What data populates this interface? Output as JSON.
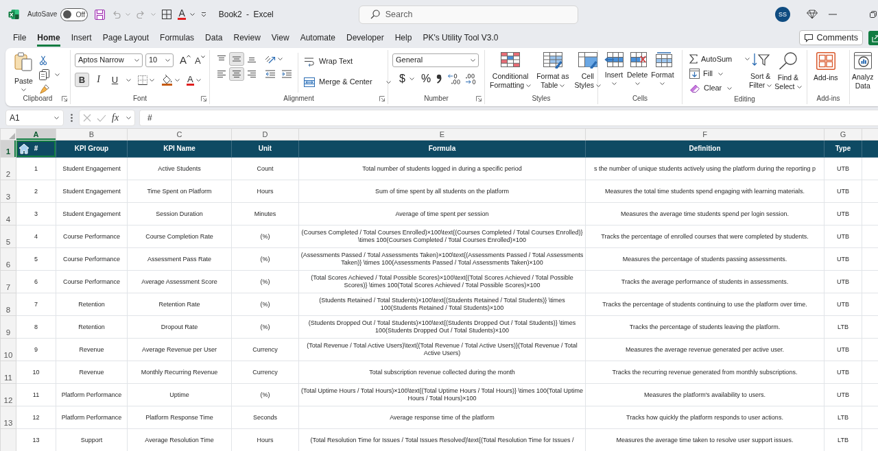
{
  "title_bar": {
    "autosave": {
      "label": "AutoSave",
      "on": false,
      "state_text": "Off"
    },
    "undo": {
      "disabled": true
    },
    "redo": {
      "disabled": true
    },
    "font_color": {
      "glyph": "A"
    },
    "title": "Book2 - Excel",
    "search": {
      "placeholder": "Search"
    },
    "account": {
      "initials": "SS"
    }
  },
  "ribbon_tabs": [
    {
      "label": "File",
      "selected": false
    },
    {
      "label": "Home",
      "selected": true
    },
    {
      "label": "Insert",
      "selected": false
    },
    {
      "label": "Page Layout",
      "selected": false
    },
    {
      "label": "Formulas",
      "selected": false
    },
    {
      "label": "Data",
      "selected": false
    },
    {
      "label": "Review",
      "selected": false
    },
    {
      "label": "View",
      "selected": false
    },
    {
      "label": "Automate",
      "selected": false
    },
    {
      "label": "Developer",
      "selected": false
    },
    {
      "label": "Help",
      "selected": false
    },
    {
      "label": "PK's Utility Tool V3.0",
      "selected": false
    }
  ],
  "comments_button": {
    "label": "Comments"
  },
  "ribbon": {
    "groups": [
      {
        "kind": "clipboard",
        "label": "Clipboard",
        "launcher": true,
        "paste": "Paste"
      },
      {
        "kind": "font",
        "label": "Font",
        "launcher": true,
        "font_name": "Aptos Narrow",
        "font_size": "10",
        "grow": "A",
        "shrink": "A",
        "style_buttons": [
          {
            "text": "B",
            "pressed": true
          },
          {
            "text": "I",
            "pressed": false
          },
          {
            "text": "U",
            "pressed": false
          }
        ],
        "font_color": "A"
      },
      {
        "kind": "alignment",
        "label": "Alignment",
        "launcher": true,
        "vertical": [
          {
            "selected": false
          },
          {
            "selected": true
          },
          {
            "selected": false
          }
        ],
        "horizontal": [
          {
            "selected": false
          },
          {
            "selected": true
          },
          {
            "selected": false
          }
        ],
        "wrap_text": "Wrap Text",
        "merge": "Merge & Center"
      },
      {
        "kind": "number",
        "label": "Number",
        "launcher": true,
        "format": "General",
        "currency": "$",
        "percent": "%"
      },
      {
        "kind": "styles",
        "label": "Styles",
        "buttons": [
          {
            "label": "Conditional\nFormatting",
            "caret": true
          },
          {
            "label": "Format as\nTable",
            "caret": true
          },
          {
            "label": "Cell\nStyles",
            "caret": true
          }
        ]
      },
      {
        "kind": "cells",
        "label": "Cells",
        "buttons": [
          {
            "label": "Insert",
            "caret": true
          },
          {
            "label": "Delete",
            "caret": true
          },
          {
            "label": "Format",
            "caret": true
          }
        ]
      },
      {
        "kind": "editing",
        "label": "Editing",
        "small": [
          {
            "label": "AutoSum",
            "caret": true
          },
          {
            "label": "Fill",
            "caret": true
          },
          {
            "label": "Clear",
            "caret": true
          }
        ],
        "large": [
          {
            "label": "Sort &\nFilter",
            "caret": true
          },
          {
            "label": "Find &\nSelect",
            "caret": true
          }
        ]
      },
      {
        "kind": "addins",
        "label": "Add-ins",
        "buttons": [
          {
            "label": "Add-ins"
          }
        ]
      },
      {
        "kind": "analyze",
        "buttons": [
          {
            "label": "Analyz\nData"
          }
        ]
      }
    ]
  },
  "formula_bar": {
    "name_box": "A1",
    "cancel": {
      "disabled": true
    },
    "enter": {
      "disabled": true
    },
    "function_label": "fx",
    "formula": "#"
  },
  "sheet": {
    "columns": [
      {
        "label": "A",
        "selected": true
      },
      {
        "label": "B",
        "selected": false
      },
      {
        "label": "C",
        "selected": false
      },
      {
        "label": "D",
        "selected": false
      },
      {
        "label": "E",
        "selected": false
      },
      {
        "label": "F",
        "selected": false
      },
      {
        "label": "G",
        "selected": false
      }
    ],
    "rows": [
      {
        "number": "1",
        "selected": true,
        "kind": "header",
        "cells": [
          "#",
          "KPI Group",
          "KPI Name",
          "Unit",
          "Formula",
          "Definition",
          "Type"
        ]
      },
      {
        "number": "2",
        "selected": false,
        "kind": "data",
        "cells": [
          "1",
          "Student Engagement",
          "Active Students",
          "Count",
          "Total number of students logged in during a specific period",
          "s the number of unique students actively using the platform during the reporting p",
          "UTB"
        ]
      },
      {
        "number": "3",
        "selected": false,
        "kind": "data",
        "cells": [
          "2",
          "Student Engagement",
          "Time Spent on Platform",
          "Hours",
          "Sum of time spent by all students on the platform",
          "Measures the total time students spend engaging with learning materials.",
          "UTB"
        ]
      },
      {
        "number": "4",
        "selected": false,
        "kind": "data",
        "cells": [
          "3",
          "Student Engagement",
          "Session Duration",
          "Minutes",
          "Average of time spent per session",
          "Measures the average time students spend per login session.",
          "UTB"
        ]
      },
      {
        "number": "5",
        "selected": false,
        "kind": "data",
        "cells": [
          "4",
          "Course Performance",
          "Course Completion Rate",
          "(%)",
          "(Courses Completed / Total Courses Enrolled)×100\\text{(Courses Completed / Total Courses Enrolled)} \\times 100(Courses Completed / Total Courses Enrolled)×100",
          "Tracks the percentage of enrolled courses that were completed by students.",
          "UTB"
        ]
      },
      {
        "number": "6",
        "selected": false,
        "kind": "data",
        "cells": [
          "5",
          "Course Performance",
          "Assessment Pass Rate",
          "(%)",
          "(Assessments Passed / Total Assessments Taken)×100\\text{(Assessments Passed / Total Assessments Taken)} \\times 100(Assessments Passed / Total Assessments Taken)×100",
          "Measures the percentage of students passing assessments.",
          "UTB"
        ]
      },
      {
        "number": "7",
        "selected": false,
        "kind": "data",
        "cells": [
          "6",
          "Course Performance",
          "Average Assessment Score",
          "(%)",
          "(Total Scores Achieved / Total Possible Scores)×100\\text{(Total Scores Achieved / Total Possible Scores)} \\times 100(Total Scores Achieved / Total Possible Scores)×100",
          "Tracks the average performance of students in assessments.",
          "UTB"
        ]
      },
      {
        "number": "8",
        "selected": false,
        "kind": "data",
        "cells": [
          "7",
          "Retention",
          "Retention Rate",
          "(%)",
          "(Students Retained / Total Students)×100\\text{(Students Retained / Total Students)} \\times 100(Students Retained / Total Students)×100",
          "Tracks the percentage of students continuing to use the platform over time.",
          "UTB"
        ]
      },
      {
        "number": "9",
        "selected": false,
        "kind": "data",
        "cells": [
          "8",
          "Retention",
          "Dropout Rate",
          "(%)",
          "(Students Dropped Out / Total Students)×100\\text{(Students Dropped Out / Total Students)} \\times 100(Students Dropped Out / Total Students)×100",
          "Tracks the percentage of students leaving the platform.",
          "LTB"
        ]
      },
      {
        "number": "10",
        "selected": false,
        "kind": "data",
        "cells": [
          "9",
          "Revenue",
          "Average Revenue per User",
          "Currency",
          "(Total Revenue / Total Active Users)\\text{(Total Revenue / Total Active Users)}(Total Revenue / Total Active Users)",
          "Measures the average revenue generated per active user.",
          "UTB"
        ]
      },
      {
        "number": "11",
        "selected": false,
        "kind": "data",
        "cells": [
          "10",
          "Revenue",
          "Monthly Recurring Revenue",
          "Currency",
          "Total subscription revenue collected during the month",
          "Tracks the recurring revenue generated from monthly subscriptions.",
          "UTB"
        ]
      },
      {
        "number": "12",
        "selected": false,
        "kind": "data",
        "cells": [
          "11",
          "Platform Performance",
          "Uptime",
          "(%)",
          "(Total Uptime Hours / Total Hours)×100\\text{(Total Uptime Hours / Total Hours)} \\times 100(Total Uptime Hours / Total Hours)×100",
          "Measures the platform's availability to users.",
          "UTB"
        ]
      },
      {
        "number": "13",
        "selected": false,
        "kind": "data",
        "cells": [
          "12",
          "Platform Performance",
          "Platform Response Time",
          "Seconds",
          "Average response time of the platform",
          "Tracks how quickly the platform responds to user actions.",
          "LTB"
        ]
      },
      {
        "selected": false,
        "kind": "data",
        "cells": [
          "13",
          "Support",
          "Average Resolution Time",
          "Hours",
          "(Total Resolution Time for Issues / Total Issues Resolved)\\text{(Total Resolution Time for Issues /",
          "Measures the average time taken to resolve user support issues.",
          "LTB"
        ]
      }
    ]
  }
}
